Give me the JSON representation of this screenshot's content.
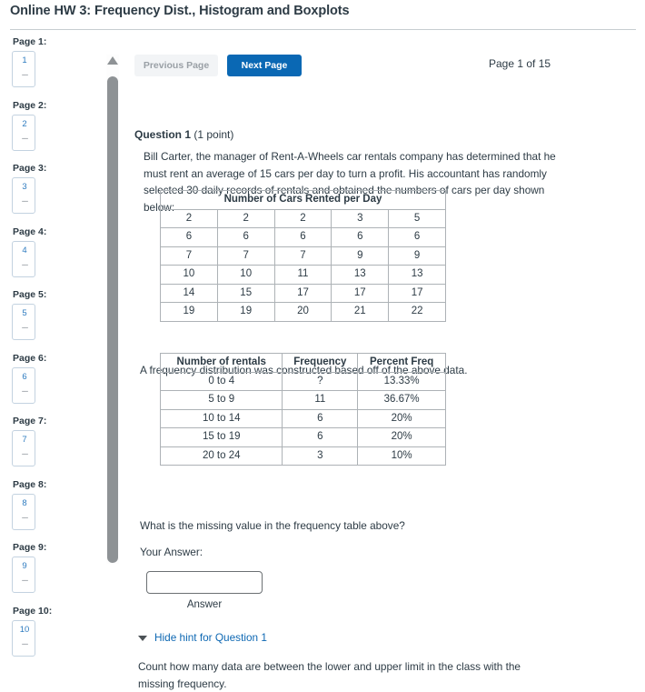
{
  "header": {
    "title": "Online HW 3: Frequency Dist., Histogram and Boxplots"
  },
  "sidebar": {
    "pages": [
      {
        "label": "Page 1:",
        "number": "1",
        "status": "---"
      },
      {
        "label": "Page 2:",
        "number": "2",
        "status": "---"
      },
      {
        "label": "Page 3:",
        "number": "3",
        "status": "---"
      },
      {
        "label": "Page 4:",
        "number": "4",
        "status": "---"
      },
      {
        "label": "Page 5:",
        "number": "5",
        "status": "---"
      },
      {
        "label": "Page 6:",
        "number": "6",
        "status": "---"
      },
      {
        "label": "Page 7:",
        "number": "7",
        "status": "---"
      },
      {
        "label": "Page 8:",
        "number": "8",
        "status": "---"
      },
      {
        "label": "Page 9:",
        "number": "9",
        "status": "---"
      },
      {
        "label": "Page 10:",
        "number": "10",
        "status": "---"
      }
    ]
  },
  "toolbar": {
    "previous_page_label": "Previous Page",
    "next_page_label": "Next Page",
    "page_counter": "Page 1 of 15"
  },
  "question": {
    "heading_title": "Question 1",
    "heading_points": " (1 point)",
    "body": "Bill Carter, the manager of Rent-A-Wheels car rentals company has determined that he must rent an average of 15 cars per day to turn a profit. His accountant has randomly selected 30 daily records of rentals and obtained the numbers of cars per day shown below:",
    "prompt": "What is the missing value in the frequency table above?",
    "your_answer_label": "Your Answer:",
    "answer_value": "",
    "answer_placeholder": "",
    "answer_caption": "Answer"
  },
  "data_table": {
    "caption": "Number of Cars Rented per Day",
    "rows": [
      [
        "2",
        "2",
        "2",
        "3",
        "5"
      ],
      [
        "6",
        "6",
        "6",
        "6",
        "6"
      ],
      [
        "7",
        "7",
        "7",
        "9",
        "9"
      ],
      [
        "10",
        "10",
        "11",
        "13",
        "13"
      ],
      [
        "14",
        "15",
        "17",
        "17",
        "17"
      ],
      [
        "19",
        "19",
        "20",
        "21",
        "22"
      ]
    ]
  },
  "freq_intro": "A frequency distribution was constructed based off of the above data.",
  "freq_table": {
    "headers": [
      "Number of rentals",
      "Frequency",
      "Percent Freq"
    ],
    "rows": [
      [
        "0 to 4",
        "?",
        "13.33%"
      ],
      [
        "5 to 9",
        "11",
        "36.67%"
      ],
      [
        "10 to 14",
        "6",
        "20%"
      ],
      [
        "15 to 19",
        "6",
        "20%"
      ],
      [
        "20 to 24",
        "3",
        "10%"
      ]
    ]
  },
  "hint": {
    "toggle_label": "Hide hint for Question 1",
    "text": "Count how many data are between the lower and upper limit in the class with the missing frequency."
  },
  "colors": {
    "accent_blue": "#0a68b4",
    "link_blue": "#0e68b3",
    "text": "#2d3b45",
    "muted": "#9aa0a6",
    "scrollbar": "#8e9295"
  }
}
